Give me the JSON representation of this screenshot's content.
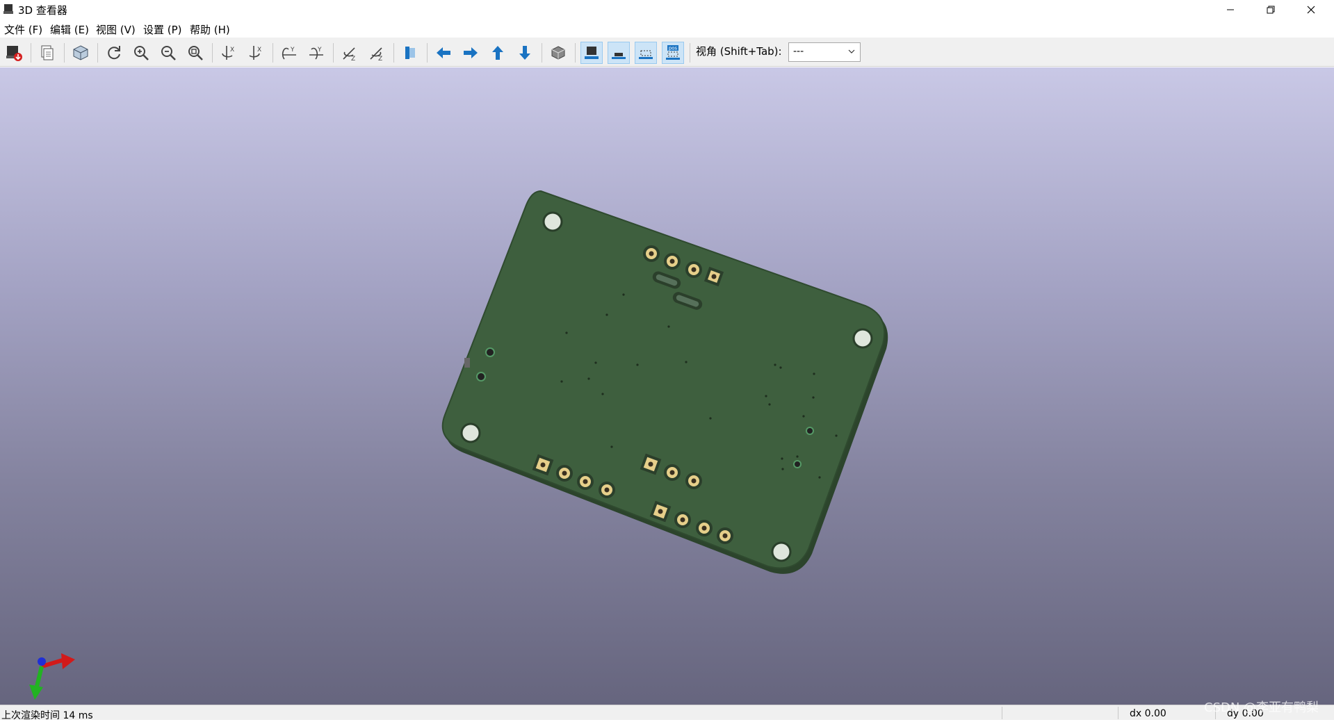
{
  "window": {
    "title": "3D 查看器"
  },
  "menu": [
    "文件 (F)",
    "编辑 (E)",
    "视图 (V)",
    "设置 (P)",
    "帮助 (H)"
  ],
  "toolbar": {
    "view_label": "视角 (Shift+Tab):",
    "view_value": "---",
    "buttons": [
      "export-icon",
      "copy-icon",
      "layers-3d-icon",
      "reload-icon",
      "zoom-in-icon",
      "zoom-out-icon",
      "zoom-fit-icon",
      "rotate-x-cw-icon",
      "rotate-x-ccw-icon",
      "rotate-y-cw-icon",
      "rotate-y-ccw-icon",
      "rotate-z-cw-icon",
      "rotate-z-ccw-icon",
      "flip-board-icon",
      "pan-left-icon",
      "pan-right-icon",
      "pan-up-icon",
      "pan-down-icon",
      "ortho-box-icon",
      "toggle-tht-icon",
      "toggle-smd-icon",
      "toggle-virtual-icon",
      "toggle-pos-icon"
    ],
    "pos_badge": "pos"
  },
  "status": {
    "render_time": "上次渲染时间 14 ms",
    "dx": "dx 0.00",
    "dy": "dy 0.00"
  },
  "watermark": "CSDN @李亚有鸭梨",
  "colors": {
    "pcb": "#3e5f3e",
    "pcb_edge": "#2c442c",
    "pad_gold": "#e6cf8a",
    "toolbar_arrow": "#1a73c2",
    "bg_top": "#c9c8e6",
    "bg_bottom": "#66657e"
  }
}
